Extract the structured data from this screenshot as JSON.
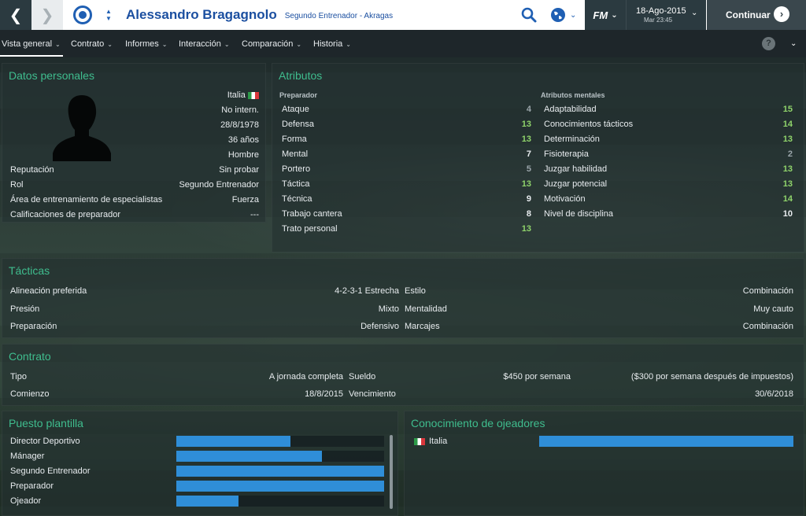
{
  "topbar": {
    "title": "Alessandro Bragagnolo",
    "subtitle": "Segundo Entrenador - Akragas",
    "fm_logo": "FM",
    "date": "18-Ago-2015",
    "time": "Mar 23:45",
    "continue_label": "Continuar",
    "icons": [
      "back-arrow-icon",
      "forward-arrow-icon",
      "club-badge-icon",
      "search-icon",
      "globe-icon",
      "chevron-down-icon"
    ]
  },
  "tabs": [
    "Vista general",
    "Contrato",
    "Informes",
    "Interacción",
    "Comparación",
    "Historia"
  ],
  "help_label": "?",
  "personal": {
    "title": "Datos personales",
    "nationality": "Italia",
    "international": "No intern.",
    "birthdate": "28/8/1978",
    "age": "36 años",
    "gender": "Hombre",
    "rows": [
      {
        "label": "Reputación",
        "value": "Sin probar"
      },
      {
        "label": "Rol",
        "value": "Segundo Entrenador"
      },
      {
        "label": "Área de entrenamiento de especialistas",
        "value": "Fuerza"
      },
      {
        "label": "Calificaciones de preparador",
        "value": "---"
      }
    ]
  },
  "attributes": {
    "title": "Atributos",
    "coach_header": "Preparador",
    "mental_header": "Atributos mentales",
    "coach": [
      {
        "label": "Ataque",
        "value": "4",
        "color": "#9aa5aa"
      },
      {
        "label": "Defensa",
        "value": "13",
        "color": "#8fd36b"
      },
      {
        "label": "Forma",
        "value": "13",
        "color": "#8fd36b"
      },
      {
        "label": "Mental",
        "value": "7",
        "color": "#e8ecef"
      },
      {
        "label": "Portero",
        "value": "5",
        "color": "#9aa5aa"
      },
      {
        "label": "Táctica",
        "value": "13",
        "color": "#8fd36b"
      },
      {
        "label": "Técnica",
        "value": "9",
        "color": "#e8ecef"
      },
      {
        "label": "Trabajo cantera",
        "value": "8",
        "color": "#e8ecef"
      },
      {
        "label": "Trato personal",
        "value": "13",
        "color": "#8fd36b"
      }
    ],
    "mental": [
      {
        "label": "Adaptabilidad",
        "value": "15",
        "color": "#8fd36b"
      },
      {
        "label": "Conocimientos tácticos",
        "value": "14",
        "color": "#8fd36b"
      },
      {
        "label": "Determinación",
        "value": "13",
        "color": "#8fd36b"
      },
      {
        "label": "Fisioterapia",
        "value": "2",
        "color": "#9aa5aa"
      },
      {
        "label": "Juzgar habilidad",
        "value": "13",
        "color": "#8fd36b"
      },
      {
        "label": "Juzgar potencial",
        "value": "13",
        "color": "#8fd36b"
      },
      {
        "label": "Motivación",
        "value": "14",
        "color": "#8fd36b"
      },
      {
        "label": "Nivel de disciplina",
        "value": "10",
        "color": "#e8ecef"
      }
    ]
  },
  "tactics": {
    "title": "Tácticas",
    "left": [
      {
        "label": "Alineación preferida",
        "value": "4-2-3-1 Estrecha"
      },
      {
        "label": "Presión",
        "value": "Mixto"
      },
      {
        "label": "Preparación",
        "value": "Defensivo"
      }
    ],
    "right": [
      {
        "label": "Estilo",
        "value": "Combinación"
      },
      {
        "label": "Mentalidad",
        "value": "Muy cauto"
      },
      {
        "label": "Marcajes",
        "value": "Combinación"
      }
    ]
  },
  "contract": {
    "title": "Contrato",
    "tipo_label": "Tipo",
    "tipo": "A jornada completa",
    "sueldo_label": "Sueldo",
    "sueldo": "$450 por semana",
    "sueldo_net": "($300 por semana después de impuestos)",
    "comienzo_label": "Comienzo",
    "comienzo": "18/8/2015",
    "vencimiento_label": "Vencimiento",
    "vencimiento": "30/6/2018"
  },
  "squad_role": {
    "title": "Puesto plantilla",
    "items": [
      {
        "label": "Director Deportivo",
        "level": 0.55
      },
      {
        "label": "Mánager",
        "level": 0.7
      },
      {
        "label": "Segundo Entrenador",
        "level": 1.0
      },
      {
        "label": "Preparador",
        "level": 1.0
      },
      {
        "label": "Ojeador",
        "level": 0.3
      }
    ]
  },
  "scouting": {
    "title": "Conocimiento de ojeadores",
    "items": [
      {
        "label": "Italia",
        "level": 1.0
      }
    ]
  },
  "colors": {
    "accent_green": "#3fbd8e",
    "bar_blue": "#2f8ed8",
    "title_blue": "#1b4fa0"
  }
}
